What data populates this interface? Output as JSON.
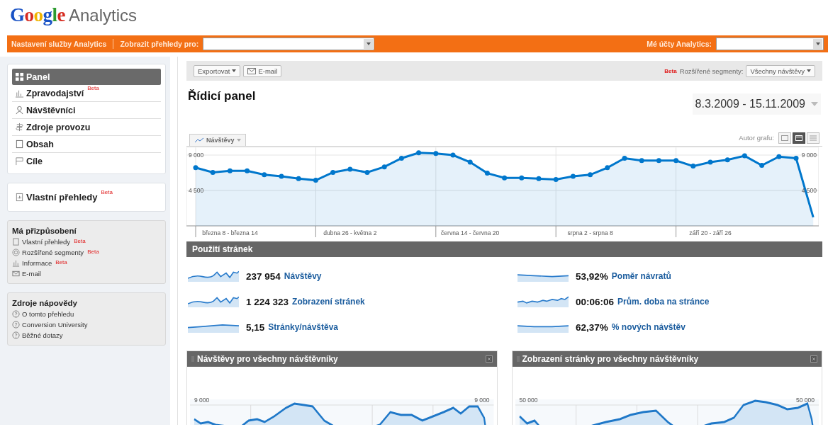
{
  "logo": {
    "brand": "Google",
    "product": "Analytics"
  },
  "top_bar": {
    "settings_link": "Nastavení služby Analytics",
    "view_label": "Zobrazit přehledy pro:",
    "accounts_label": "Mé účty Analytics:"
  },
  "nav": [
    {
      "label": "Panel",
      "selected": true
    },
    {
      "label": "Zpravodajství",
      "beta": "Beta",
      "selected": false
    },
    {
      "label": "Návštěvníci",
      "selected": false
    },
    {
      "label": "Zdroje provozu",
      "selected": false
    },
    {
      "label": "Obsah",
      "selected": false
    },
    {
      "label": "Cíle",
      "selected": false
    }
  ],
  "custom_reports": {
    "label": "Vlastní přehledy",
    "beta": "Beta"
  },
  "customization": {
    "title": "Má přizpůsobení",
    "items": [
      {
        "label": "Vlastní přehledy",
        "beta": "Beta"
      },
      {
        "label": "Rozšířené segmenty",
        "beta": "Beta"
      },
      {
        "label": "Informace",
        "beta": "Beta"
      },
      {
        "label": "E-mail"
      }
    ]
  },
  "help": {
    "title": "Zdroje nápovědy",
    "items": [
      "O tomto přehledu",
      "Conversion University",
      "Běžné dotazy"
    ]
  },
  "toolbar": {
    "export": "Exportovat",
    "email": "E-mail",
    "beta": "Beta",
    "segments_label": "Rozšířené segmenty:",
    "segments_value": "Všechny návštěvy"
  },
  "page_title": "Řídicí panel",
  "date_range": "8.3.2009 - 15.11.2009",
  "chart": {
    "graph_by_label": "Autor grafu:",
    "views": [
      {
        "selected": false
      },
      {
        "selected": true
      },
      {
        "selected": false
      }
    ],
    "right_axis_labels": [
      "9 000",
      "4 500"
    ],
    "chart_data": {
      "type": "area",
      "categories": [
        null,
        null,
        "března 8 - března 14",
        null,
        null,
        null,
        null,
        null,
        null,
        "dubna 26 - května 2",
        null,
        null,
        null,
        null,
        null,
        null,
        "června 14 - června 20",
        null,
        null,
        null,
        null,
        null,
        null,
        "srpna 2 - srpna 8",
        null,
        null,
        null,
        null,
        null,
        null,
        "září 20 - září 26",
        null,
        null,
        null,
        null,
        null,
        null
      ],
      "ylim": [
        0,
        10000
      ],
      "grid": true,
      "series": [
        {
          "name": "Návštěvy",
          "color": "#0077cc",
          "values": [
            7400,
            6800,
            7000,
            7000,
            6500,
            6300,
            6000,
            5800,
            6800,
            7200,
            6800,
            7500,
            8600,
            9300,
            9200,
            9000,
            8100,
            6700,
            6100,
            6100,
            6000,
            5900,
            6300,
            6500,
            7400,
            8600,
            8300,
            8300,
            8300,
            7600,
            8100,
            8400,
            8900,
            7700,
            8800,
            8600,
            1100
          ]
        }
      ],
      "yticks": [
        {
          "value": 4500,
          "label": "4 500"
        },
        {
          "value": 9000,
          "label": "9 000"
        }
      ]
    }
  },
  "site_usage": {
    "title": "Použití stránek",
    "metrics": [
      {
        "value": "237 954",
        "label": "Návštěvy"
      },
      {
        "value": "53,92%",
        "label": "Poměr návratů"
      },
      {
        "value": "1 224 323",
        "label": "Zobrazení stránek"
      },
      {
        "value": "00:06:06",
        "label": "Prům. doba na stránce"
      },
      {
        "value": "5,15",
        "label": "Stránky/návštěva"
      },
      {
        "value": "62,37%",
        "label": "% nových návštěv"
      }
    ]
  },
  "panels": [
    {
      "title": "Návštěvy pro všechny návštěvníky",
      "tick_left": "9 000",
      "tick_right": "9 000"
    },
    {
      "title": "Zobrazení stránky pro všechny návštěvníky",
      "tick_left": "50 000",
      "tick_right": "50 000"
    }
  ]
}
